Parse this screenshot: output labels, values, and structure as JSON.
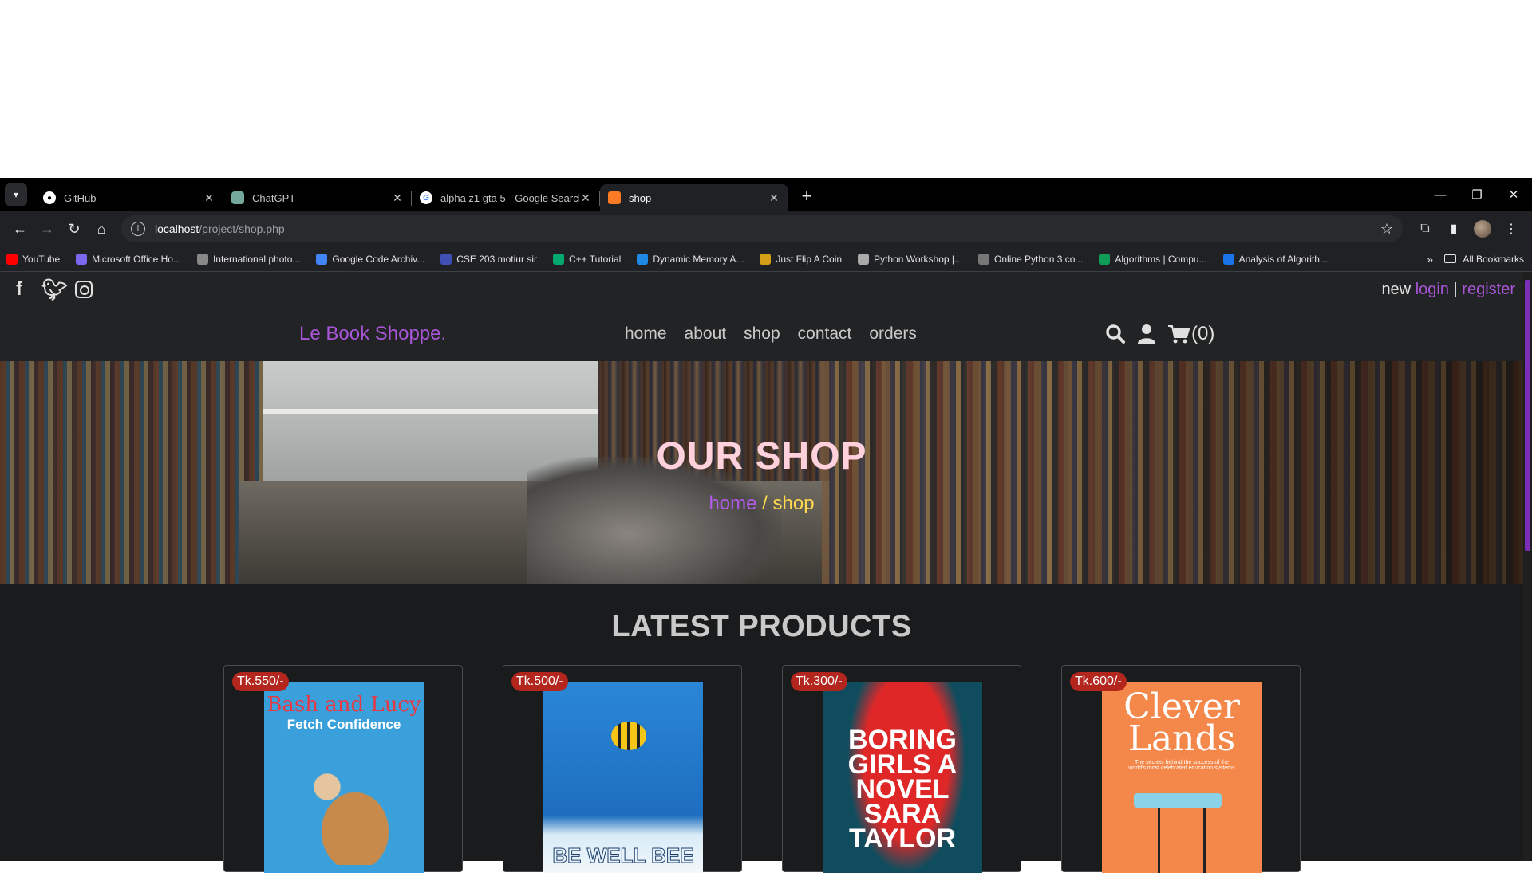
{
  "browser": {
    "tabs": [
      {
        "title": "GitHub",
        "favicon": "github-icon",
        "color": "#ffffff"
      },
      {
        "title": "ChatGPT",
        "favicon": "chatgpt-icon",
        "color": "#74aa9c"
      },
      {
        "title": "alpha z1 gta 5 - Google Search",
        "favicon": "google-icon",
        "color": "#4285f4"
      },
      {
        "title": "shop",
        "favicon": "xampp-icon",
        "color": "#fb7a24"
      }
    ],
    "url_host": "localhost",
    "url_path": "/project/shop.php",
    "bookmarks": [
      {
        "label": "YouTube",
        "color": "#ff0000"
      },
      {
        "label": "Microsoft Office Ho...",
        "color": "#7b68ee"
      },
      {
        "label": "International photo...",
        "color": "#888888"
      },
      {
        "label": "Google Code Archiv...",
        "color": "#4285f4"
      },
      {
        "label": "CSE 203 motiur sir",
        "color": "#3f51b5"
      },
      {
        "label": "C++ Tutorial",
        "color": "#04aa6d"
      },
      {
        "label": "Dynamic Memory A...",
        "color": "#1e88e5"
      },
      {
        "label": "Just Flip A Coin",
        "color": "#d4a017"
      },
      {
        "label": "Python Workshop |...",
        "color": "#aaaaaa"
      },
      {
        "label": "Online Python 3 co...",
        "color": "#777777"
      },
      {
        "label": "Algorithms | Compu...",
        "color": "#0f9d58"
      },
      {
        "label": "Analysis of Algorith...",
        "color": "#1a73e8"
      }
    ],
    "all_bookmarks": "All Bookmarks"
  },
  "site": {
    "auth_new": "new",
    "auth_login": "login",
    "auth_sep": "|",
    "auth_register": "register",
    "logo": "Le Book Shoppe.",
    "nav": [
      "home",
      "about",
      "shop",
      "contact",
      "orders"
    ],
    "cart_count": "(0)",
    "hero_title": "OUR SHOP",
    "crumb_home": "home",
    "crumb_rest": "/ shop",
    "products_title": "LATEST PRODUCTS",
    "accent": "#a855d8"
  },
  "products": [
    {
      "price": "Tk.550/-",
      "cover_line1": "Bash and Lucy",
      "cover_line2": "Fetch Confidence"
    },
    {
      "price": "Tk.500/-",
      "cover_line1": "BE WELL BEE"
    },
    {
      "price": "Tk.300/-",
      "cover_line1": "BORING GIRLS A NOVEL SARA TAYLOR"
    },
    {
      "price": "Tk.600/-",
      "cover_line1": "Clever Lands",
      "cover_line2": "The secrets behind the success of the world's most celebrated education systems"
    }
  ]
}
